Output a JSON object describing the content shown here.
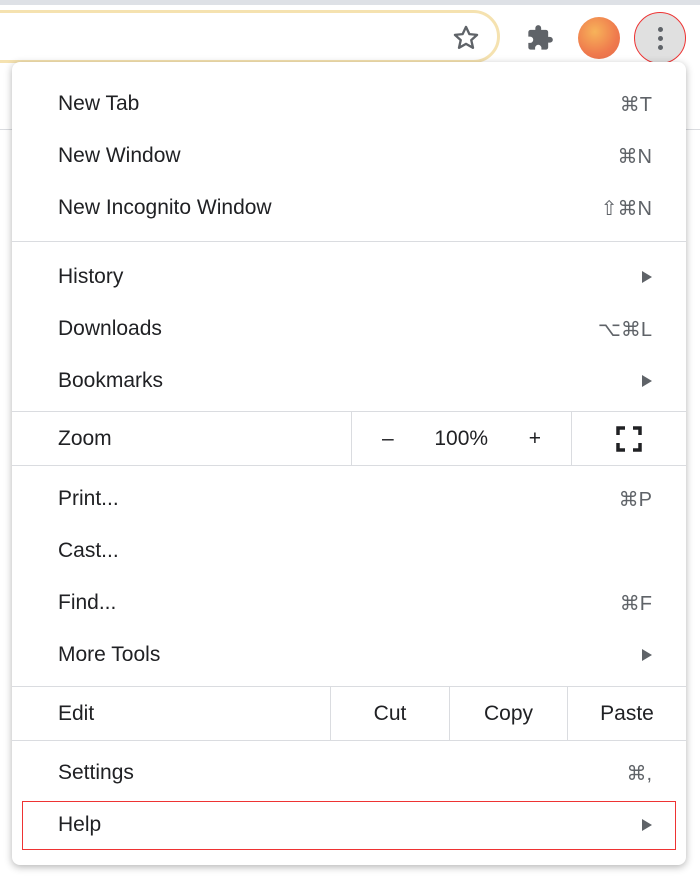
{
  "toolbar": {
    "icons": [
      "star-icon",
      "extensions-puzzle-icon",
      "profile-avatar",
      "more-menu-kebab-icon"
    ]
  },
  "menu": {
    "group1": [
      {
        "label": "New Tab",
        "shortcut": "⌘T"
      },
      {
        "label": "New Window",
        "shortcut": "⌘N"
      },
      {
        "label": "New Incognito Window",
        "shortcut": "⇧⌘N"
      }
    ],
    "group2": [
      {
        "label": "History",
        "submenu": true
      },
      {
        "label": "Downloads",
        "shortcut": "⌥⌘L"
      },
      {
        "label": "Bookmarks",
        "submenu": true
      }
    ],
    "zoom": {
      "label": "Zoom",
      "minus": "–",
      "value": "100%",
      "plus": "+"
    },
    "group3": [
      {
        "label": "Print...",
        "shortcut": "⌘P"
      },
      {
        "label": "Cast..."
      },
      {
        "label": "Find...",
        "shortcut": "⌘F"
      },
      {
        "label": "More Tools",
        "submenu": true
      }
    ],
    "edit": {
      "label": "Edit",
      "cut": "Cut",
      "copy": "Copy",
      "paste": "Paste"
    },
    "group4": [
      {
        "label": "Settings",
        "shortcut": "⌘,"
      },
      {
        "label": "Help",
        "submenu": true
      }
    ]
  },
  "highlight_color": "#e33333"
}
